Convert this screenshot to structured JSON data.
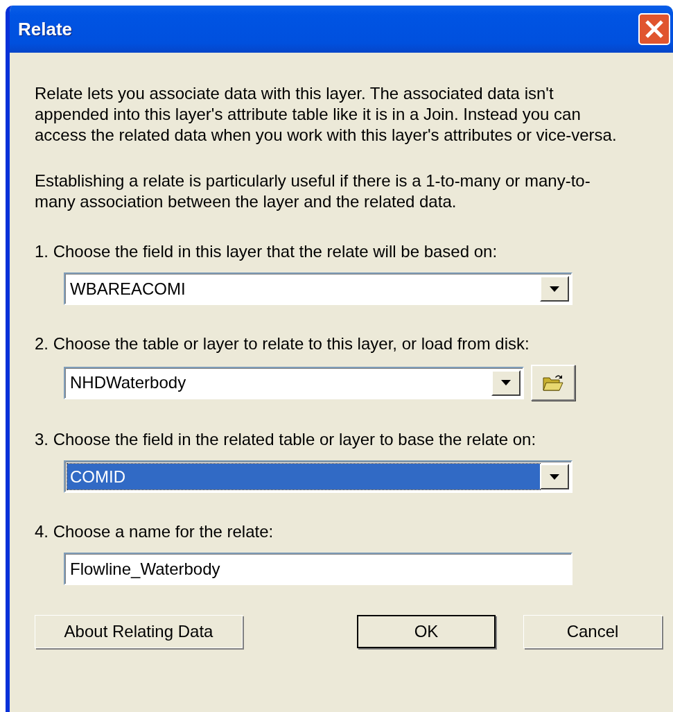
{
  "window": {
    "title": "Relate"
  },
  "paragraphs": [
    "Relate lets you associate data with this layer. The associated data isn't appended into this layer's attribute table like it is in a Join. Instead you can access the related data when you work with this layer's attributes or vice-versa.",
    "Establishing a relate is particularly useful if there is a 1-to-many or many-to-many association between the layer and the related data."
  ],
  "steps": [
    {
      "label": "1. Choose the field in this layer that the relate will be based on:",
      "kind": "combo",
      "value": "WBAREACOMI",
      "focused": false,
      "browse": false
    },
    {
      "label": "2. Choose the table or layer to relate to this layer, or load from disk:",
      "kind": "combo",
      "value": "NHDWaterbody",
      "focused": false,
      "browse": true
    },
    {
      "label": "3. Choose the field in the related table or layer to base the relate on:",
      "kind": "combo",
      "value": "COMID",
      "focused": true,
      "browse": false
    },
    {
      "label": "4. Choose a name for the relate:",
      "kind": "text",
      "value": "Flowline_Waterbody",
      "focused": false,
      "browse": false
    }
  ],
  "buttons": [
    {
      "label": "About Relating Data",
      "default": false
    },
    {
      "label": "OK",
      "default": true
    },
    {
      "label": "Cancel",
      "default": false
    }
  ]
}
